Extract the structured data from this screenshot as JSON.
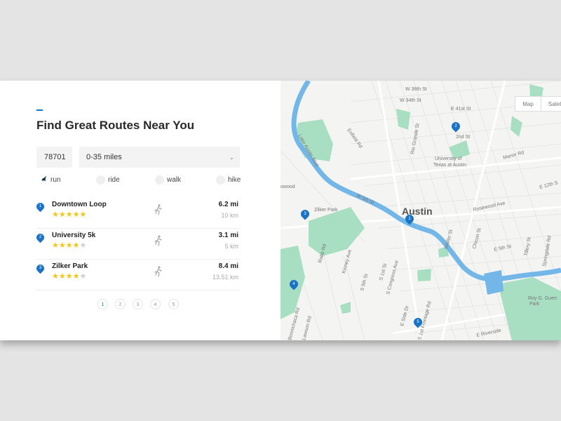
{
  "panel": {
    "title": "Find Great Routes Near You",
    "zip": "78701",
    "distance": "0-35 miles",
    "modes": [
      {
        "label": "run",
        "checked": true
      },
      {
        "label": "ride",
        "checked": false
      },
      {
        "label": "walk",
        "checked": false
      },
      {
        "label": "hike",
        "checked": false
      }
    ],
    "routes": [
      {
        "num": "1",
        "name": "Downtown Loop",
        "rating": 5,
        "mi": "6.2 mi",
        "km": "10 km"
      },
      {
        "num": "2",
        "name": "University 5k",
        "rating": 4,
        "mi": "3.1 mi",
        "km": "5 km"
      },
      {
        "num": "3",
        "name": "Zilker Park",
        "rating": 4,
        "mi": "8.4 mi",
        "km": "13.51 km"
      }
    ],
    "pages": [
      "1",
      "2",
      "3",
      "4",
      "5"
    ],
    "active_page": "1"
  },
  "map": {
    "toggle_map": "Map",
    "toggle_satellite": "Satel",
    "city_label": "Austin",
    "pins": [
      "1",
      "2",
      "3",
      "4",
      "5"
    ],
    "streets": [
      "W 38th St",
      "W 34th St",
      "E 41st St",
      "Lake Austin Blvd",
      "Enfield Rd",
      "Rio Grande St",
      "University of",
      "Texas at Austin",
      "Manor Rd",
      "E 12th S",
      "W 5th St",
      "Zilker Park",
      "Rosewood Ave",
      "Chicon St",
      "E 5th St",
      "Tillery St",
      "Springdale Rd",
      "Waller St",
      "Rabb Rd",
      "Kinney Ave",
      "S 5th St",
      "S 1st St",
      "S Congress Ave",
      "E Side Dr",
      "S 1st Frontage Rd",
      "E Riverside",
      "Roy G. Guerr",
      "Park",
      "2nd St",
      "Bonnichaca Rd",
      "Lawson Rd",
      "owood"
    ]
  },
  "colors": {
    "accent": "#1a73c4",
    "park": "#a8dfc2",
    "water": "#73b7e8",
    "star": "#f5c518"
  }
}
